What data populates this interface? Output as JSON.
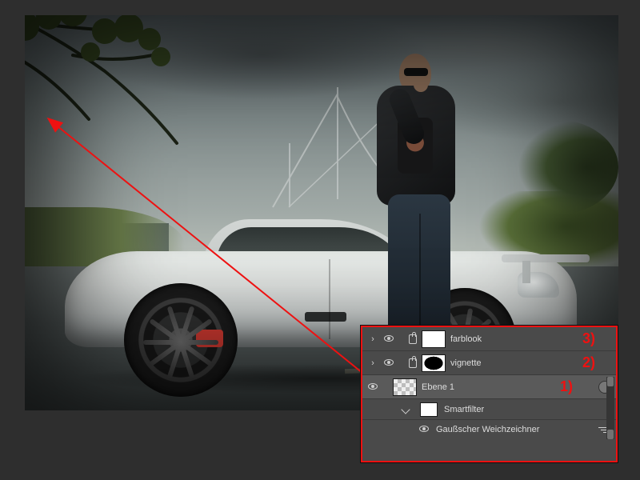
{
  "layers": {
    "row1": {
      "name": "farblook",
      "annot": "3)"
    },
    "row2": {
      "name": "vignette",
      "annot": "2)"
    },
    "row3": {
      "name": "Ebene 1",
      "annot": "1)"
    },
    "smartfilter_label": "Smartfilter",
    "filter_name": "Gaußscher Weichzeichner"
  }
}
